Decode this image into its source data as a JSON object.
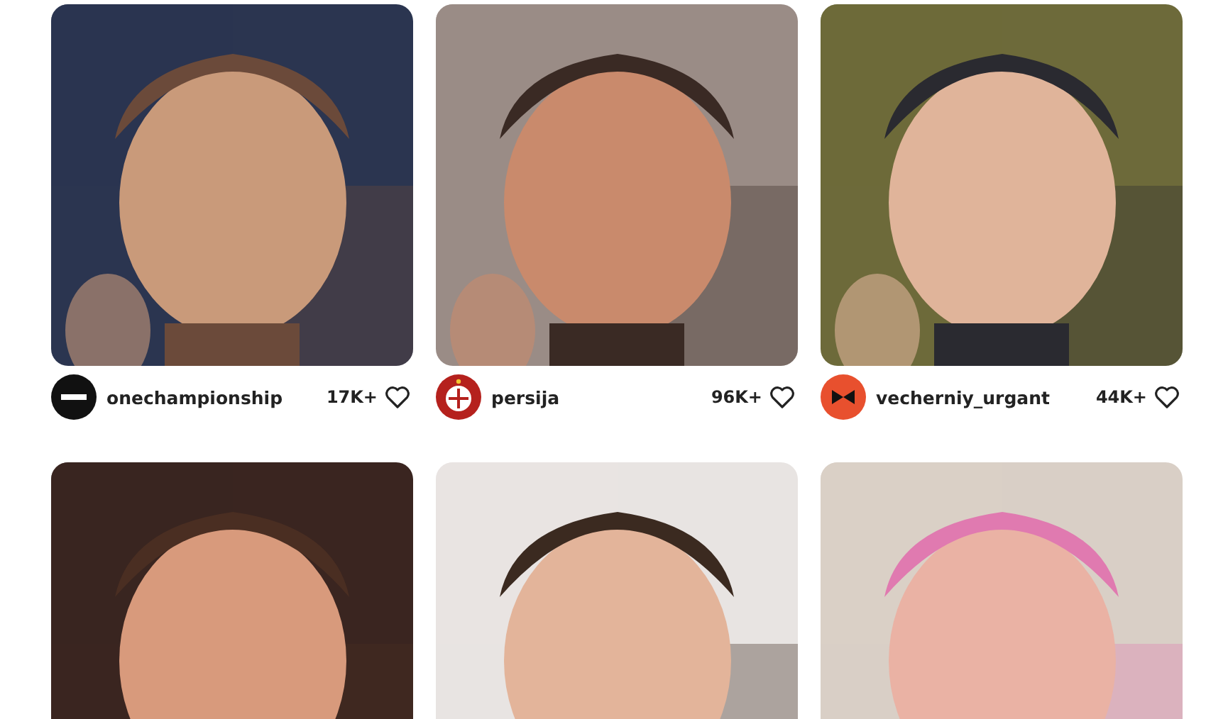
{
  "posts": [
    {
      "kind": "picture",
      "username": "onechampionship",
      "likes": "17K+"
    },
    {
      "kind": "picture",
      "username": "persija",
      "likes": "96K+"
    },
    {
      "kind": "picture",
      "username": "vecherniy_urgant",
      "likes": "44K+"
    },
    {
      "kind": "picture"
    },
    {
      "kind": "picture"
    },
    {
      "kind": "picture"
    }
  ]
}
